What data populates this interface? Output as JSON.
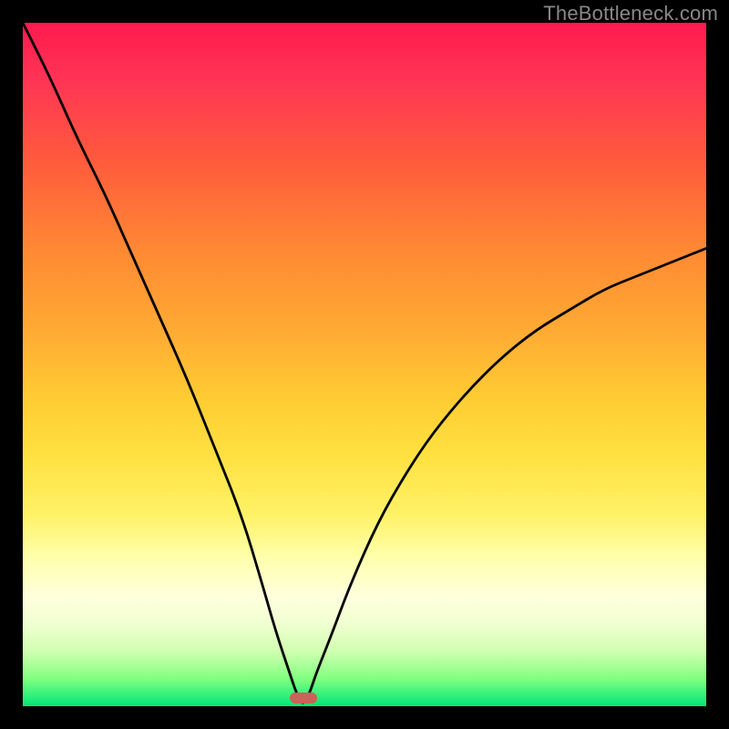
{
  "watermark": "TheBottleneck.com",
  "chart_data": {
    "type": "line",
    "title": "",
    "xlabel": "",
    "ylabel": "",
    "x_range": [
      0,
      100
    ],
    "y_range": [
      0,
      100
    ],
    "background_gradient": {
      "top_color": "#ff1a4d",
      "middle_color": "#ffe040",
      "bottom_color": "#00e676"
    },
    "min_marker": {
      "x": 41,
      "y": 0,
      "color": "#c86458"
    },
    "series": [
      {
        "name": "bottleneck-curve",
        "description": "V-shaped curve dipping to zero near x≈41, steeper on the left branch, shallower on the right branch; represents bottleneck percentage vs component scaling.",
        "x": [
          0,
          4,
          8,
          12,
          16,
          20,
          24,
          28,
          32,
          35,
          37,
          39,
          40,
          41,
          42,
          43,
          45,
          48,
          52,
          56,
          60,
          65,
          70,
          75,
          80,
          85,
          90,
          95,
          100
        ],
        "y": [
          100,
          92,
          83,
          75,
          66,
          57,
          48,
          38,
          28,
          18,
          11,
          5,
          2,
          0,
          2,
          5,
          10,
          18,
          27,
          34,
          40,
          46,
          51,
          55,
          58,
          61,
          63,
          65,
          67
        ]
      }
    ]
  }
}
